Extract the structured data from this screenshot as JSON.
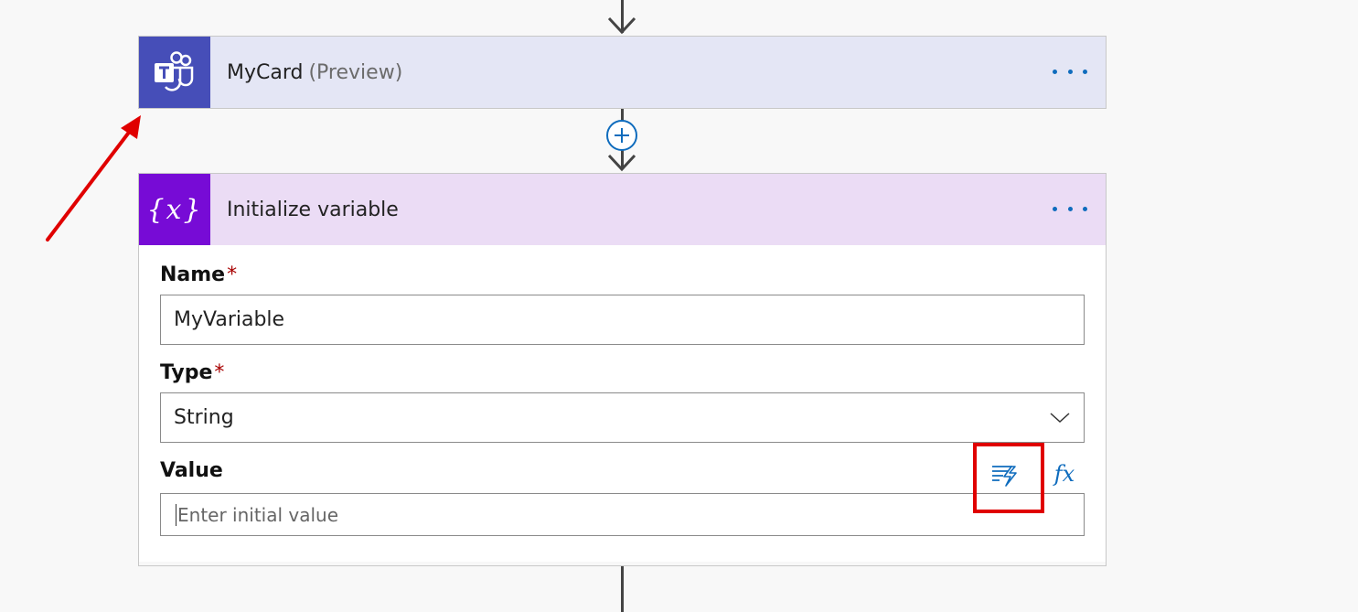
{
  "mycard_step": {
    "icon": "teams-icon",
    "title": "MyCard",
    "subtitle": "(Preview)",
    "menu_icon": "more-options-icon",
    "colors": {
      "icon_bg": "#464eb8",
      "header_bg": "#e4e6f5"
    }
  },
  "add_step": {
    "icon": "plus-circle-icon"
  },
  "init_variable_step": {
    "icon": "variable-icon",
    "icon_text": "{x}",
    "title": "Initialize variable",
    "menu_icon": "more-options-icon",
    "colors": {
      "icon_bg": "#770bd6",
      "header_bg": "#ebdcf5"
    },
    "fields": {
      "name": {
        "label": "Name",
        "required_marker": "*",
        "value": "MyVariable"
      },
      "type": {
        "label": "Type",
        "required_marker": "*",
        "value": "String"
      },
      "value": {
        "label": "Value",
        "placeholder": "Enter initial value",
        "dynamic_content_icon": "dynamic-content-icon",
        "expression_label": "fx"
      }
    }
  },
  "annotations": {
    "arrow_color": "#e00000",
    "highlight_color": "#e00000"
  }
}
